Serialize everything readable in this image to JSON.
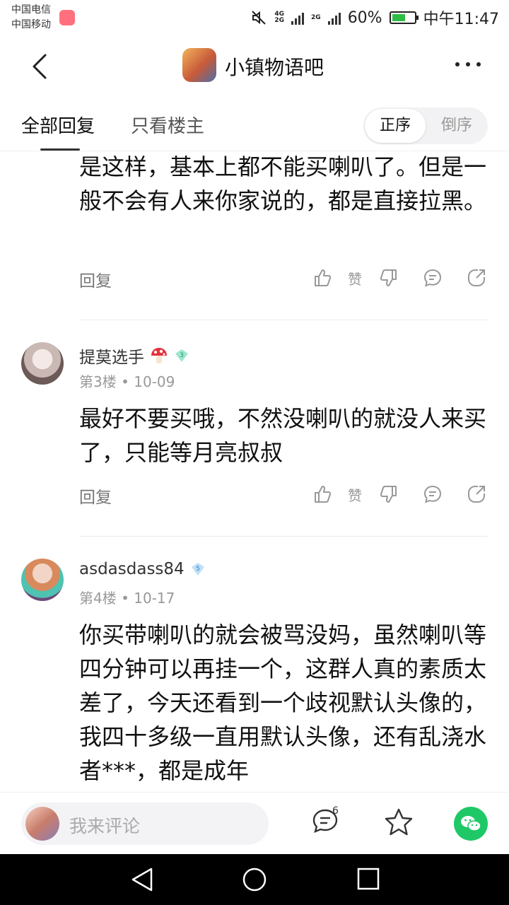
{
  "status_bar": {
    "carrier_1": "中国电信",
    "carrier_2": "中国移动",
    "network_1": "4G",
    "network_2": "2G",
    "network_3": "2G",
    "battery": "60%",
    "time": "中午11:47",
    "battery_level": 0.6
  },
  "header": {
    "forum_name": "小镇物语吧",
    "back_icon": "chevron-left-icon",
    "more_icon": "more-dots-icon"
  },
  "tabs": {
    "all_replies": "全部回复",
    "op_only": "只看楼主",
    "sort_asc": "正序",
    "sort_desc": "倒序"
  },
  "posts": [
    {
      "text": "是这样，基本上都不能买喇叭了。但是一般不会有人来你家说的，都是直接拉黑。",
      "reply": "回复",
      "like": "赞"
    },
    {
      "username": "提莫选手",
      "level": "3",
      "floor": "第3楼",
      "date": "10-09",
      "text": "最好不要买哦，不然没喇叭的就没人来买了，只能等月亮叔叔",
      "reply": "回复",
      "like": "赞"
    },
    {
      "username": "asdasdass84",
      "level": "5",
      "floor": "第4楼",
      "date": "10-17",
      "text": "你买带喇叭的就会被骂没妈，虽然喇叭等四分钟可以再挂一个，这群人真的素质太差了，今天还看到一个歧视默认头像的，我四十多级一直用默认头像，还有乱浇水者***，都是成年"
    }
  ],
  "bottom": {
    "comment_placeholder": "我来评论",
    "comment_count": "6"
  },
  "colors": {
    "wechat_green": "#1ec866",
    "battery_green": "#2dbb45",
    "level_diamond": "#7dd3c0"
  }
}
